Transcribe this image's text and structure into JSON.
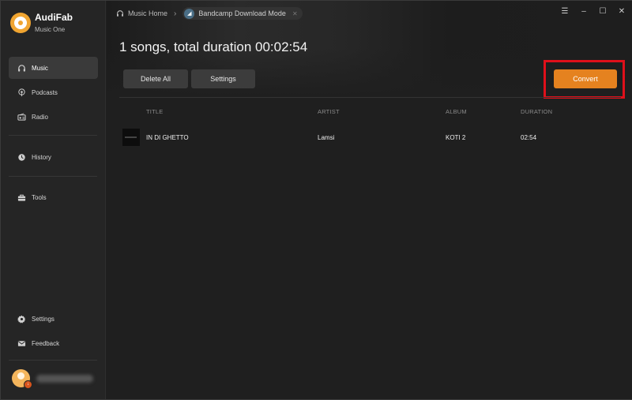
{
  "app": {
    "brand_name": "AudiFab",
    "brand_sub": "Music One"
  },
  "sidebar": {
    "items": [
      {
        "label": "Music",
        "icon": "headphones-icon",
        "active": true
      },
      {
        "label": "Podcasts",
        "icon": "podcast-icon"
      },
      {
        "label": "Radio",
        "icon": "radio-icon"
      },
      {
        "label": "History",
        "icon": "clock-icon"
      },
      {
        "label": "Tools",
        "icon": "toolbox-icon"
      },
      {
        "label": "Settings",
        "icon": "gear-icon"
      },
      {
        "label": "Feedback",
        "icon": "mail-icon"
      }
    ]
  },
  "topbar": {
    "home_label": "Music Home",
    "current_label": "Bandcamp Download Mode"
  },
  "main": {
    "heading": "1 songs, total duration 00:02:54",
    "delete_all_label": "Delete All",
    "settings_label": "Settings",
    "convert_label": "Convert"
  },
  "table": {
    "columns": [
      "TITLE",
      "ARTIST",
      "ALBUM",
      "DURATION"
    ],
    "rows": [
      {
        "title": "IN DI GHETTO",
        "artist": "Lamsi",
        "album": "KOTI 2",
        "duration": "02:54"
      }
    ]
  },
  "colors": {
    "accent": "#e5821f",
    "highlight_box": "#e0101a",
    "logo": "#f0a531"
  }
}
